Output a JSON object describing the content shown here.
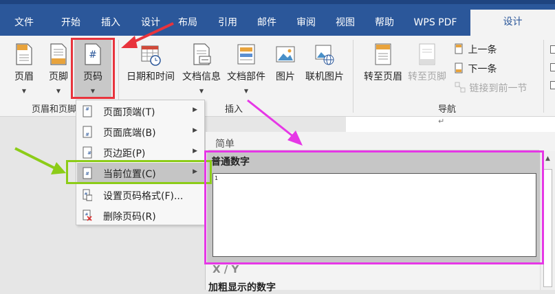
{
  "tabs": [
    "文件",
    "开始",
    "插入",
    "设计",
    "布局",
    "引用",
    "邮件",
    "审阅",
    "视图",
    "帮助",
    "WPS PDF",
    "设计"
  ],
  "ribbon": {
    "header_footer": {
      "header": "页眉",
      "footer": "页脚",
      "page_number": "页码",
      "group_label": "页眉和页脚"
    },
    "insert": {
      "date_time": "日期和时间",
      "doc_info": "文档信息",
      "doc_parts": "文档部件",
      "picture": "图片",
      "online_picture": "联机图片",
      "group_label": "插入"
    },
    "navigation": {
      "goto_header": "转至页眉",
      "goto_footer": "转至页脚",
      "prev": "上一条",
      "next": "下一条",
      "link_previous": "链接到前一节",
      "group_label": "导航"
    }
  },
  "menu": {
    "items": [
      {
        "label": "页面顶端(T)",
        "has_sub": true
      },
      {
        "label": "页面底端(B)",
        "has_sub": true
      },
      {
        "label": "页边距(P)",
        "has_sub": true
      },
      {
        "label": "当前位置(C)",
        "has_sub": true
      },
      {
        "label": "设置页码格式(F)...",
        "has_sub": false
      },
      {
        "label": "删除页码(R)",
        "has_sub": false
      }
    ]
  },
  "gallery": {
    "section_simple": "简单",
    "tile_name": "普通数字",
    "preview_number": "1",
    "section_xy": "X / Y",
    "next_item": "加粗显示的数字"
  },
  "doc": {
    "paragraph_mark": "↵"
  },
  "colors": {
    "accent": "#2b579a",
    "red_box": "#e8333c",
    "green_box": "#8ccc18",
    "magenta_box": "#e637e6"
  }
}
